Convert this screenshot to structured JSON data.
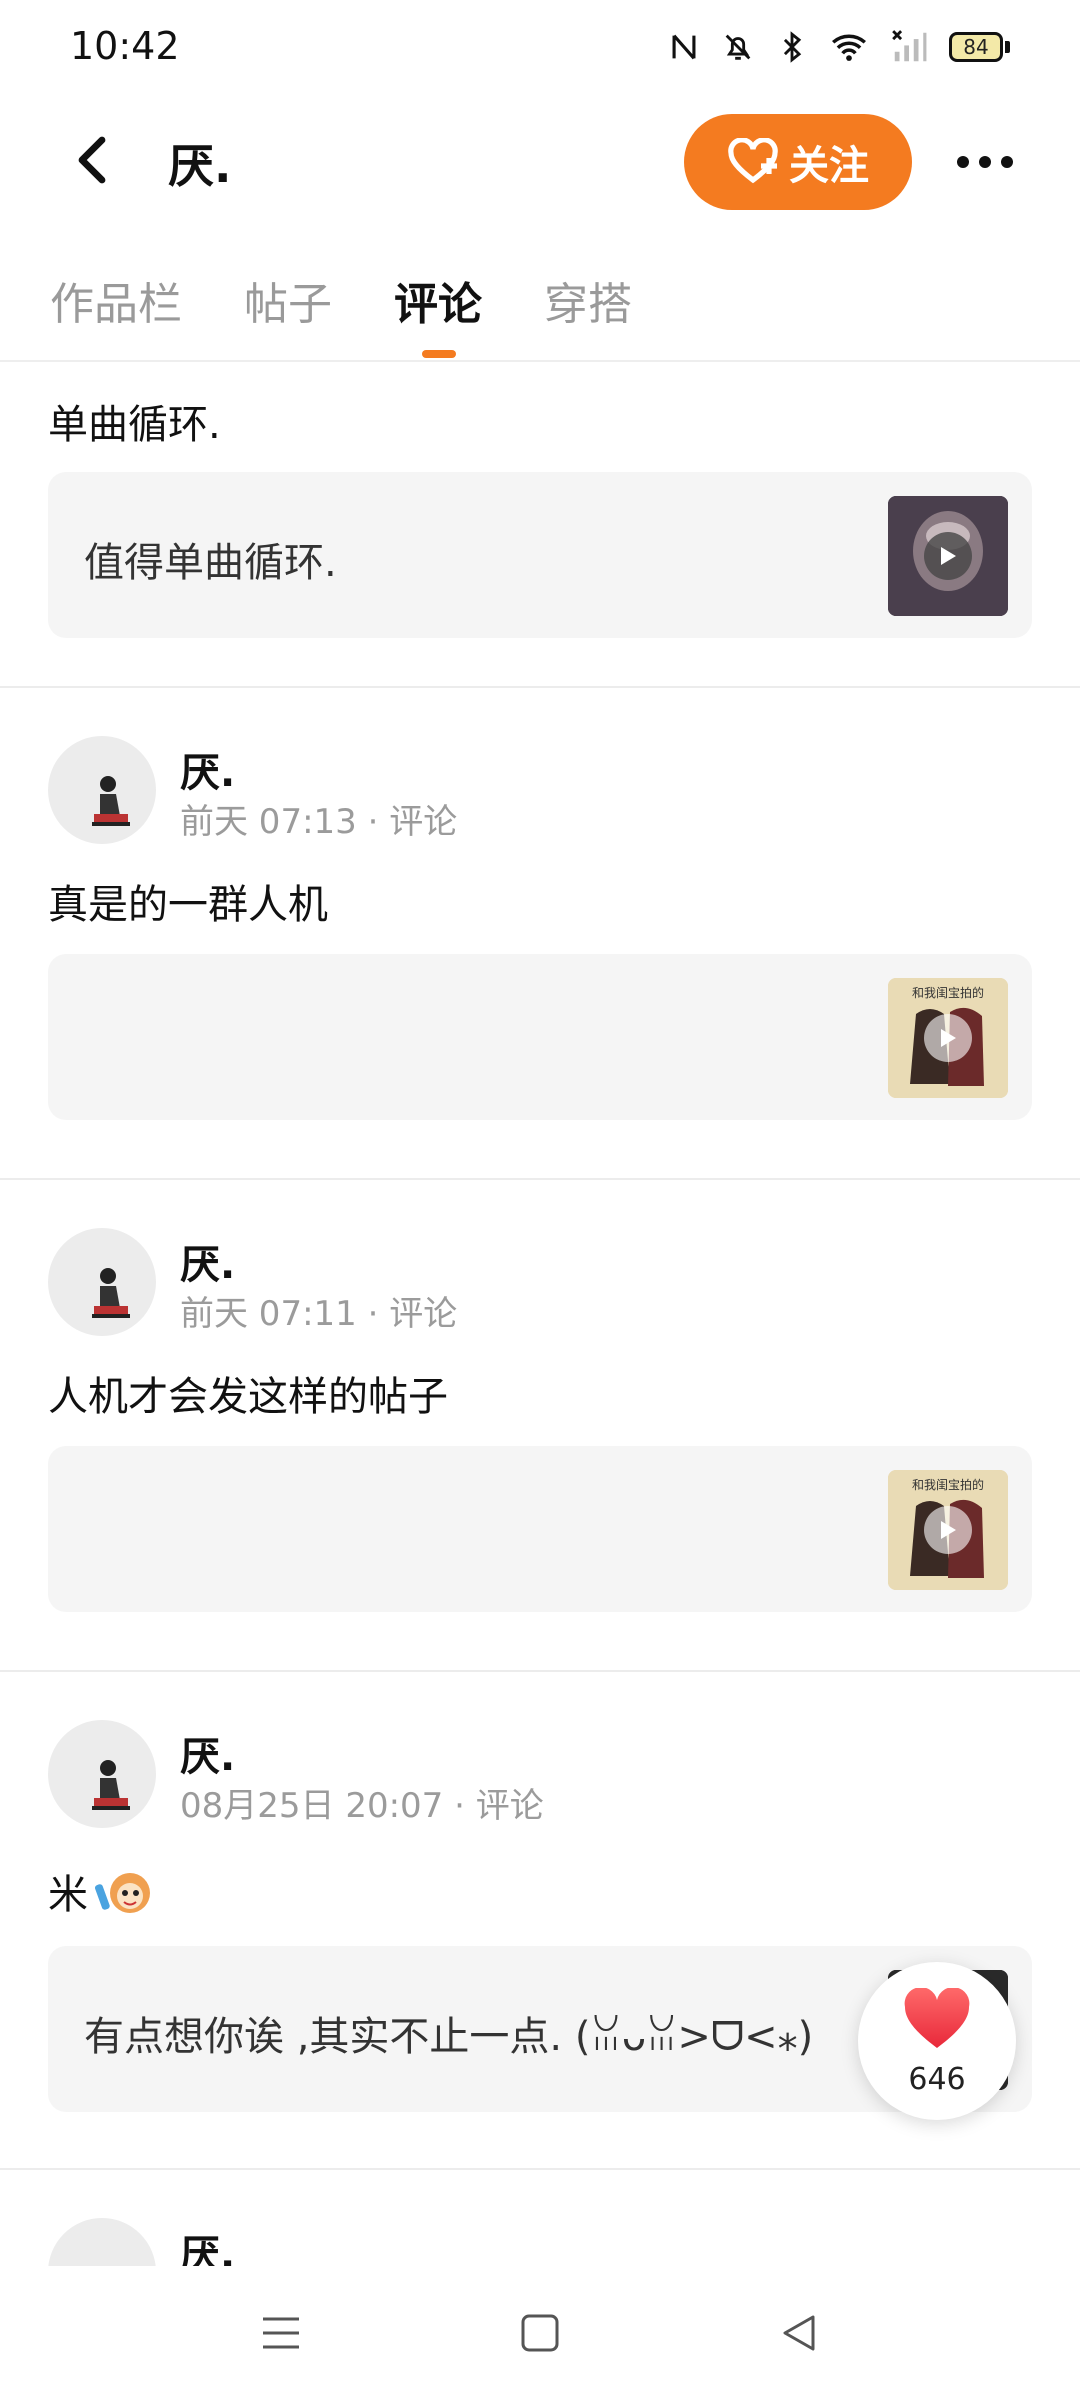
{
  "status_bar": {
    "time": "10:42",
    "battery": "84",
    "icons": [
      "nfc-icon",
      "bell-muted-icon",
      "bluetooth-icon",
      "wifi-icon",
      "signal-icon",
      "battery-icon"
    ]
  },
  "header": {
    "title": "厌.",
    "follow_label": "关注"
  },
  "tabs": [
    {
      "label": "作品栏"
    },
    {
      "label": "帖子"
    },
    {
      "label": "评论",
      "active": true
    },
    {
      "label": "穿搭"
    }
  ],
  "posts": [
    {
      "text": "单曲循环.",
      "card_text": "值得单曲循环."
    },
    {
      "username": "厌.",
      "time": "前天 07:13",
      "type": "评论",
      "text": "真是的一群人机",
      "card_text": "",
      "thumb_caption": "和我闺宝拍的"
    },
    {
      "username": "厌.",
      "time": "前天 07:11",
      "type": "评论",
      "text": "人机才会发这样的帖子",
      "card_text": "",
      "thumb_caption": "和我闺宝拍的"
    },
    {
      "username": "厌.",
      "time": "08月25日 20:07",
      "type": "评论",
      "text": "米",
      "card_text": "有点想你诶 ,其实不止一点. (ꈍᴗꈍ>ᗜ<⁎)"
    },
    {
      "username": "厌."
    }
  ],
  "like": {
    "count": "646"
  },
  "colors": {
    "accent": "#f47b20",
    "card_bg": "#f5f5f5",
    "muted_text": "#9b9b9b"
  }
}
